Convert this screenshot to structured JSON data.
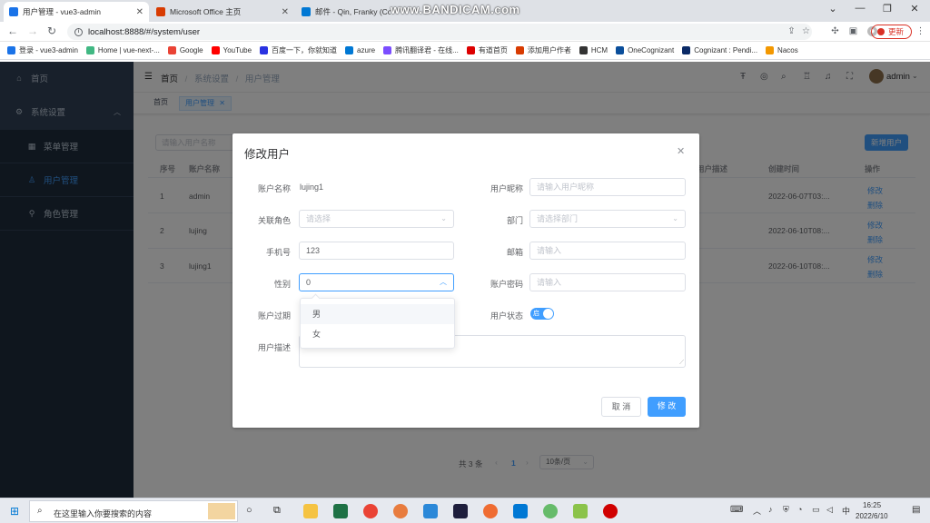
{
  "browser": {
    "tabs": [
      {
        "title": "用户管理 - vue3-admin",
        "color": "#1a73e8"
      },
      {
        "title": "Microsoft Office 主页",
        "color": "#d83b01"
      },
      {
        "title": "邮件 - Qin, Franky (Co",
        "color": "#0078d4"
      }
    ],
    "watermark": "www.BANDICAM.com",
    "url": "localhost:8888/#/system/user",
    "update_label": "更新",
    "bookmarks": [
      {
        "label": "登录 - vue3-admin",
        "color": "#1a73e8"
      },
      {
        "label": "Home | vue-next-...",
        "color": "#41b883"
      },
      {
        "label": "Google",
        "color": "#ea4335"
      },
      {
        "label": "YouTube",
        "color": "#ff0000"
      },
      {
        "label": "百度一下，你就知道",
        "color": "#2932e1"
      },
      {
        "label": "azure",
        "color": "#0078d4"
      },
      {
        "label": "腾讯翻译君 - 在线...",
        "color": "#7b4dff"
      },
      {
        "label": "有道首页",
        "color": "#d00"
      },
      {
        "label": "添加用户作者",
        "color": "#d83b01"
      },
      {
        "label": "HCM",
        "color": "#333"
      },
      {
        "label": "OneCognizant",
        "color": "#0a4e9b"
      },
      {
        "label": "Cognizant : Pendi...",
        "color": "#0a2a66"
      },
      {
        "label": "Nacos",
        "color": "#f39800"
      }
    ]
  },
  "sidebar": {
    "items": [
      {
        "label": "首页",
        "icon": "home-icon"
      },
      {
        "label": "系统设置",
        "icon": "gear-icon"
      },
      {
        "label": "菜单管理",
        "icon": "grid-icon"
      },
      {
        "label": "用户管理",
        "icon": "user-icon"
      },
      {
        "label": "角色管理",
        "icon": "role-icon"
      }
    ]
  },
  "navbar": {
    "breadcrumb": [
      "首页",
      "系统设置",
      "用户管理"
    ],
    "user": "admin"
  },
  "tags": [
    "首页",
    "用户管理"
  ],
  "toolbar": {
    "search_placeholder": "请输入用户名称",
    "add_label": "新增用户"
  },
  "table": {
    "headers": [
      "序号",
      "账户名称",
      "用户描述",
      "创建时间",
      "操作"
    ],
    "rows": [
      {
        "index": "1",
        "name": "admin",
        "time": "2022-06-07T03:..."
      },
      {
        "index": "2",
        "name": "lujing",
        "time": "2022-06-10T08:..."
      },
      {
        "index": "3",
        "name": "lujing1",
        "time": "2022-06-10T08:..."
      }
    ],
    "edit_label": "修改",
    "delete_label": "删除"
  },
  "pagination": {
    "total": "共 3 条",
    "current": "1",
    "page_size": "10条/页"
  },
  "dialog": {
    "title": "修改用户",
    "fields": {
      "account_label": "账户名称",
      "account_value": "lujing1",
      "nickname_label": "用户昵称",
      "nickname_placeholder": "请输入用户昵称",
      "role_label": "关联角色",
      "role_placeholder": "请选择",
      "dept_label": "部门",
      "dept_placeholder": "请选择部门",
      "phone_label": "手机号",
      "phone_value": "123",
      "email_label": "邮箱",
      "email_placeholder": "请输入",
      "gender_label": "性别",
      "gender_value": "0",
      "password_label": "账户密码",
      "password_placeholder": "请输入",
      "expire_label": "账户过期",
      "status_label": "用户状态",
      "status_toggle_text": "启",
      "desc_label": "用户描述"
    },
    "gender_options": [
      "男",
      "女"
    ],
    "cancel_label": "取 消",
    "submit_label": "修 改"
  },
  "taskbar": {
    "search_placeholder": "在这里输入你要搜索的内容",
    "time": "16:25",
    "date": "2022/6/10"
  }
}
